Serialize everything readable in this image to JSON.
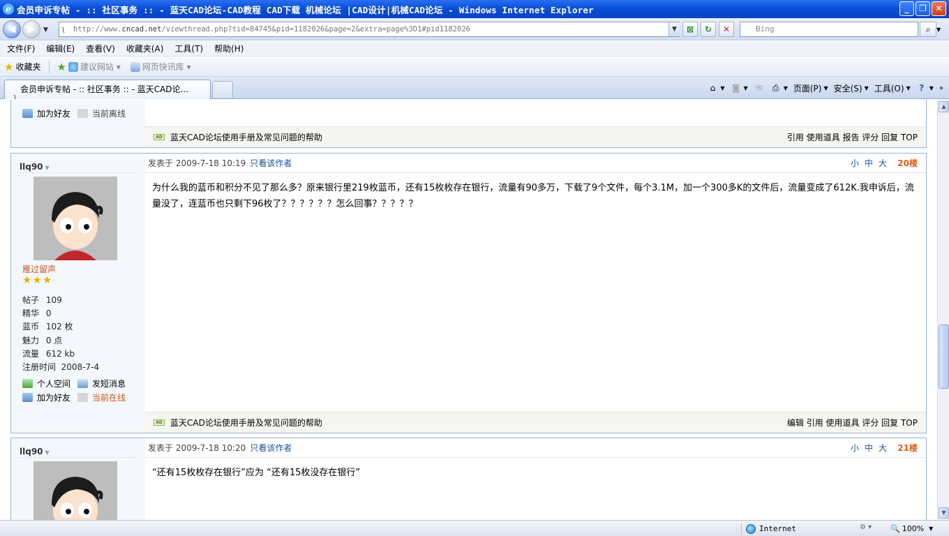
{
  "window": {
    "title": "会员申诉专帖 - :: 社区事务 :: - 蓝天CAD论坛-CAD教程 CAD下载 机械论坛 |CAD设计|机械CAD论坛 - Windows Internet Explorer",
    "buttons": [
      "_",
      "❐",
      "✕"
    ]
  },
  "address": {
    "url_prefix": "http://www.",
    "url_site": "cncad.net",
    "url_rest": "/viewthread.php?tid=84745&pid=1182026&page=2&extra=page%3D1#pid1182026",
    "search_placeholder": "Bing"
  },
  "menu": [
    "文件(F)",
    "编辑(E)",
    "查看(V)",
    "收藏夹(A)",
    "工具(T)",
    "帮助(H)"
  ],
  "favorites": {
    "label": "收藏夹",
    "items": [
      {
        "label": "建议网站 ▾"
      },
      {
        "label": "网页快讯库 ▾"
      }
    ]
  },
  "tab": {
    "label": "会员申诉专帖 - :: 社区事务 :: - 蓝天CAD论..."
  },
  "commands": {
    "page": "页面(P)",
    "safety": "安全(S)",
    "tools": "工具(O)"
  },
  "prev_post": {
    "links": [
      {
        "label": "加为好友"
      },
      {
        "label": "当前离线"
      }
    ],
    "footer_ad": "蓝天CAD论坛使用手册及常见问题的帮助",
    "footer_actions": "引用 使用道具 报告 评分 回复 TOP"
  },
  "posts": [
    {
      "username": "llq90",
      "posted": "发表于 2009-7-18 10:19",
      "only_author": "只看该作者",
      "font_sizes": "小中大",
      "floor": "20楼",
      "body": "为什么我的蓝币和积分不见了那么多？原来银行里219枚蓝币，还有15枚枚存在银行，流量有90多万，下载了9个文件，每个3.1M，加一个300多K的文件后，流量变成了612K.我申诉后，流量没了，连蓝币也只剩下96枚了？？？？？？怎么回事？？？？？",
      "rank": "雁过留声",
      "stars": "★★★",
      "stats": [
        {
          "k": "帖子",
          "v": "109"
        },
        {
          "k": "精华",
          "v": "0"
        },
        {
          "k": "蓝币",
          "v": "102 枚"
        },
        {
          "k": "魅力",
          "v": "0 点"
        },
        {
          "k": "流量",
          "v": "612 kb"
        },
        {
          "k": "注册时间",
          "v": "2008-7-4"
        }
      ],
      "links": {
        "space": "个人空间",
        "message": "发短消息",
        "friend": "加为好友",
        "status": "当前在线"
      },
      "footer_ad": "蓝天CAD论坛使用手册及常见问题的帮助",
      "footer_actions": "编辑 引用 使用道具 评分 回复 TOP"
    },
    {
      "username": "llq90",
      "posted": "发表于 2009-7-18 10:20",
      "only_author": "只看该作者",
      "font_sizes": "小中大",
      "floor": "21楼",
      "body": "“还有15枚枚存在银行”应为 “还有15枚没存在银行”"
    }
  ],
  "status": {
    "zone": "Internet",
    "zoom": "100%"
  },
  "colors": {
    "accent": "#1a4f9c",
    "floor": "#e15d19",
    "online": "#d0521a"
  }
}
